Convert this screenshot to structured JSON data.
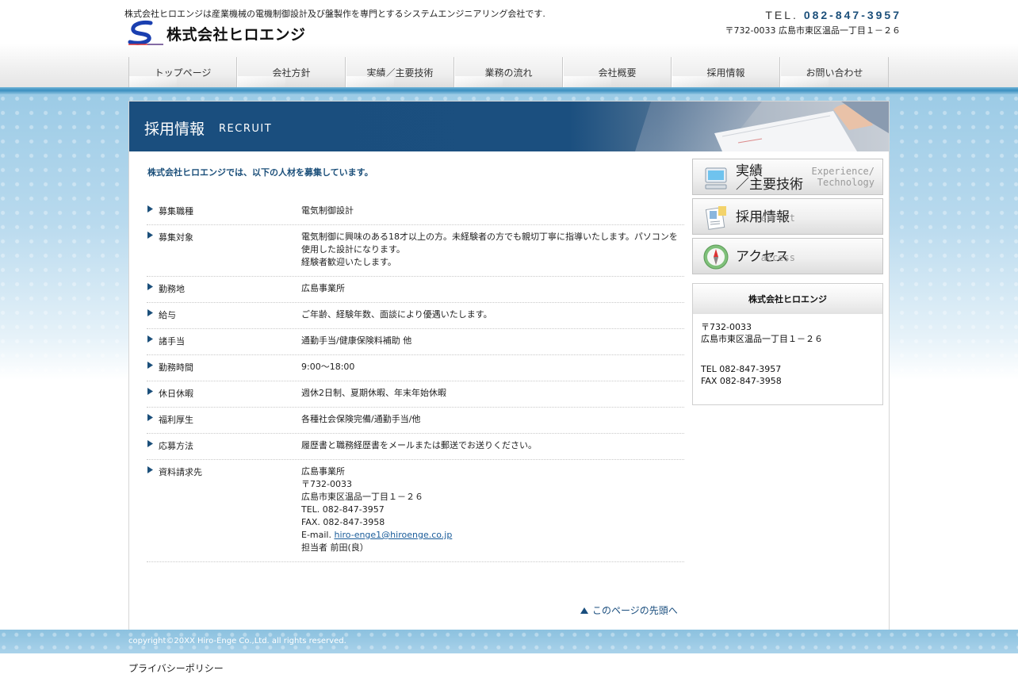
{
  "header": {
    "tagline": "株式会社ヒロエンジは産業機械の電機制御設計及び盤製作を専門とするシステムエンジニアリング会社です.",
    "logo_text": "株式会社ヒロエンジ",
    "tel_label": "TEL.",
    "tel_number": "082-847-3957",
    "address": "〒732-0033 広島市東区温品一丁目１－２６"
  },
  "nav": {
    "items": [
      "トップページ",
      "会社方針",
      "実績／主要技術",
      "業務の流れ",
      "会社概要",
      "採用情報",
      "お問い合わせ"
    ]
  },
  "banner": {
    "title": "採用情報",
    "subtitle": "RECRUIT"
  },
  "intro": "株式会社ヒロエンジでは、以下の人材を募集しています。",
  "recruit": [
    {
      "key": "募集職種",
      "lines": [
        "電気制御設計"
      ]
    },
    {
      "key": "募集対象",
      "lines": [
        "電気制御に興味のある18才以上の方。未経験者の方でも親切丁寧に指導いたします。パソコンを使用した設計になります。",
        "経験者歓迎いたします。"
      ]
    },
    {
      "key": "勤務地",
      "lines": [
        "広島事業所"
      ]
    },
    {
      "key": "給与",
      "lines": [
        "ご年齢、経験年数、面談により優遇いたします。"
      ]
    },
    {
      "key": "諸手当",
      "lines": [
        "通勤手当/健康保険料補助 他"
      ]
    },
    {
      "key": "勤務時間",
      "lines": [
        "9:00～18:00"
      ]
    },
    {
      "key": "休日休暇",
      "lines": [
        "週休2日制、夏期休暇、年末年始休暇"
      ]
    },
    {
      "key": "福利厚生",
      "lines": [
        "各種社会保険完備/通勤手当/他"
      ]
    },
    {
      "key": "応募方法",
      "lines": [
        "履歴書と職務経歴書をメールまたは郵送でお送りください。"
      ]
    },
    {
      "key": "資料請求先",
      "lines": [
        "広島事業所",
        "〒732-0033",
        "広島市東区温品一丁目１－２６",
        "TEL. 082-847-3957",
        "FAX. 082-847-3958"
      ],
      "email_label": "E-mail. ",
      "email": "hiro-enge1@hiroenge.co.jp",
      "contact": "担当者 前田(良）"
    }
  ],
  "to_top": "このページの先頭へ",
  "sidebar": {
    "buttons": [
      {
        "label_line1": "実績",
        "label_line2": "／主要技術",
        "en_line1": "Experience/",
        "en_line2": "Technology",
        "icon": "monitor-icon"
      },
      {
        "label": "採用情報",
        "en": "recruit",
        "icon": "document-icon"
      },
      {
        "label": "アクセス",
        "en": "access",
        "icon": "compass-icon"
      }
    ],
    "company": {
      "name": "株式会社ヒロエンジ",
      "zip": "〒732-0033",
      "address": "広島市東区温品一丁目１－２６",
      "tel": "TEL 082-847-3957",
      "fax": "FAX 082-847-3958"
    }
  },
  "footer": {
    "copyright": "copyright©20XX Hiro-Enge Co.,Ltd. all rights reserved.",
    "privacy": "プライバシーポリシー"
  },
  "colors": {
    "brand_blue": "#1b4f7a",
    "stripe_blue": "#3a8fc0"
  }
}
